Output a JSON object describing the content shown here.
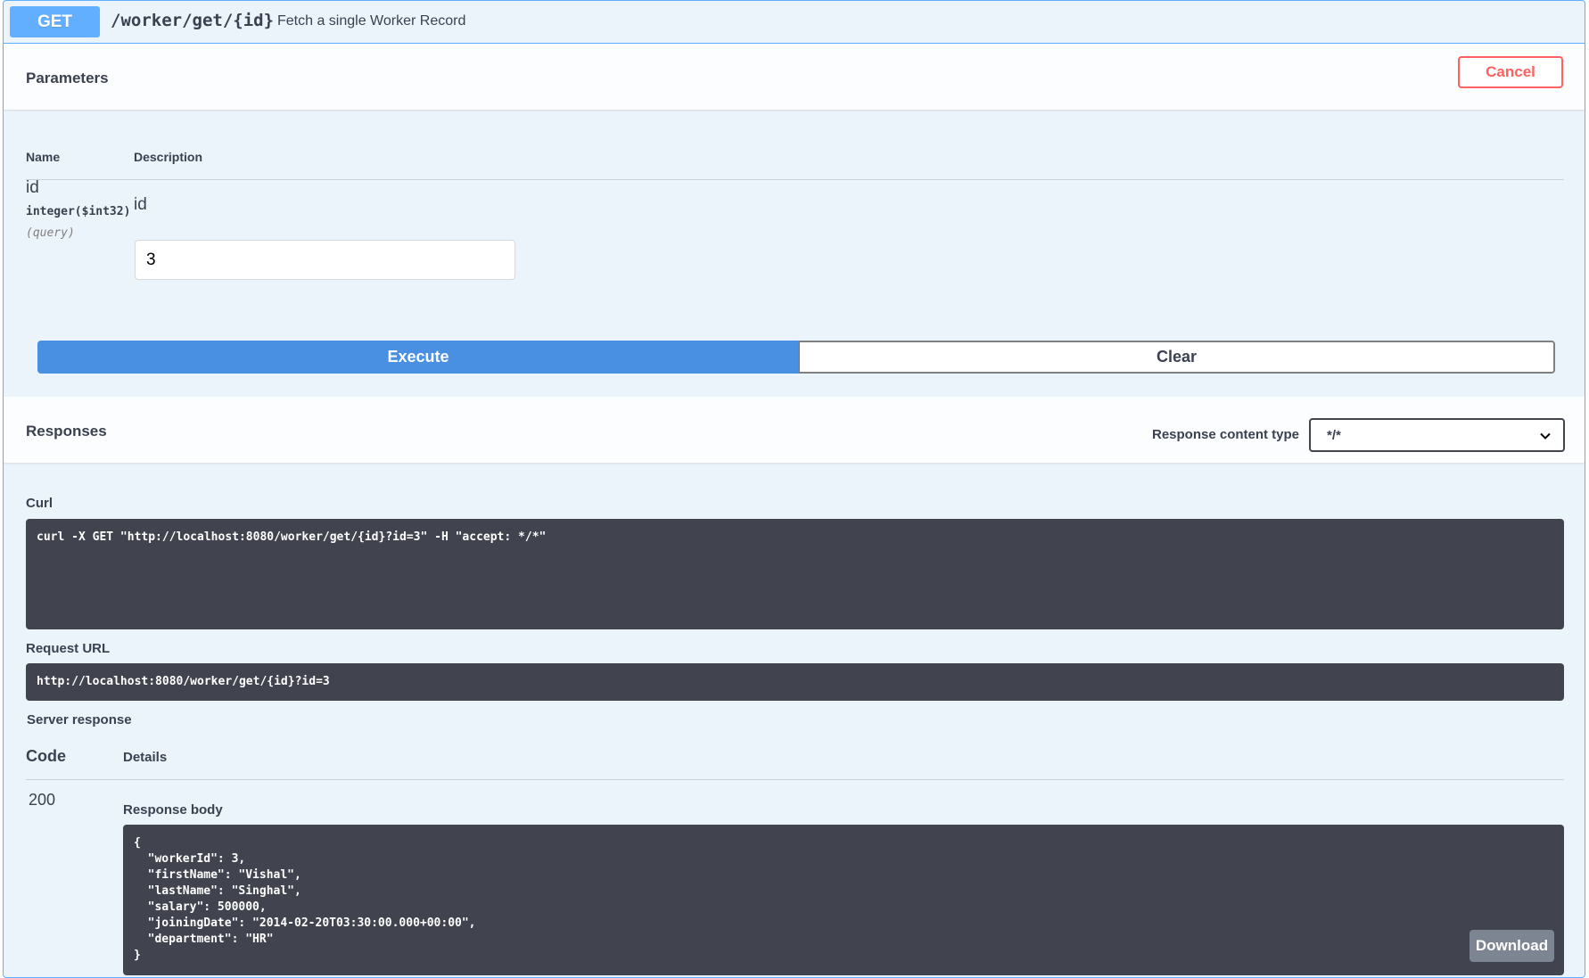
{
  "operation": {
    "method": "GET",
    "path": "/worker/get/{id}",
    "summary": "Fetch a single Worker Record"
  },
  "parameters": {
    "title": "Parameters",
    "cancel_label": "Cancel",
    "col_name": "Name",
    "col_description": "Description",
    "items": [
      {
        "name": "id",
        "type": "integer($int32)",
        "in": "(query)",
        "description": "id",
        "value": "3"
      }
    ]
  },
  "actions": {
    "execute_label": "Execute",
    "clear_label": "Clear"
  },
  "responses": {
    "title": "Responses",
    "content_type_label": "Response content type",
    "content_type_value": "*/*",
    "curl_label": "Curl",
    "curl_command": "curl -X GET \"http://localhost:8080/worker/get/{id}?id=3\" -H \"accept: */*\"",
    "request_url_label": "Request URL",
    "request_url": "http://localhost:8080/worker/get/{id}?id=3",
    "server_response_label": "Server response",
    "col_code": "Code",
    "col_details": "Details",
    "code": "200",
    "response_body_label": "Response body",
    "response_body": "{\n  \"workerId\": 3,\n  \"firstName\": \"Vishal\",\n  \"lastName\": \"Singhal\",\n  \"salary\": 500000,\n  \"joiningDate\": \"2014-02-20T03:30:00.000+00:00\",\n  \"department\": \"HR\"\n}",
    "download_label": "Download"
  },
  "colors": {
    "get": "#61affe",
    "execute": "#4990e2",
    "cancel": "#ff6060",
    "code_bg": "#41444e"
  }
}
